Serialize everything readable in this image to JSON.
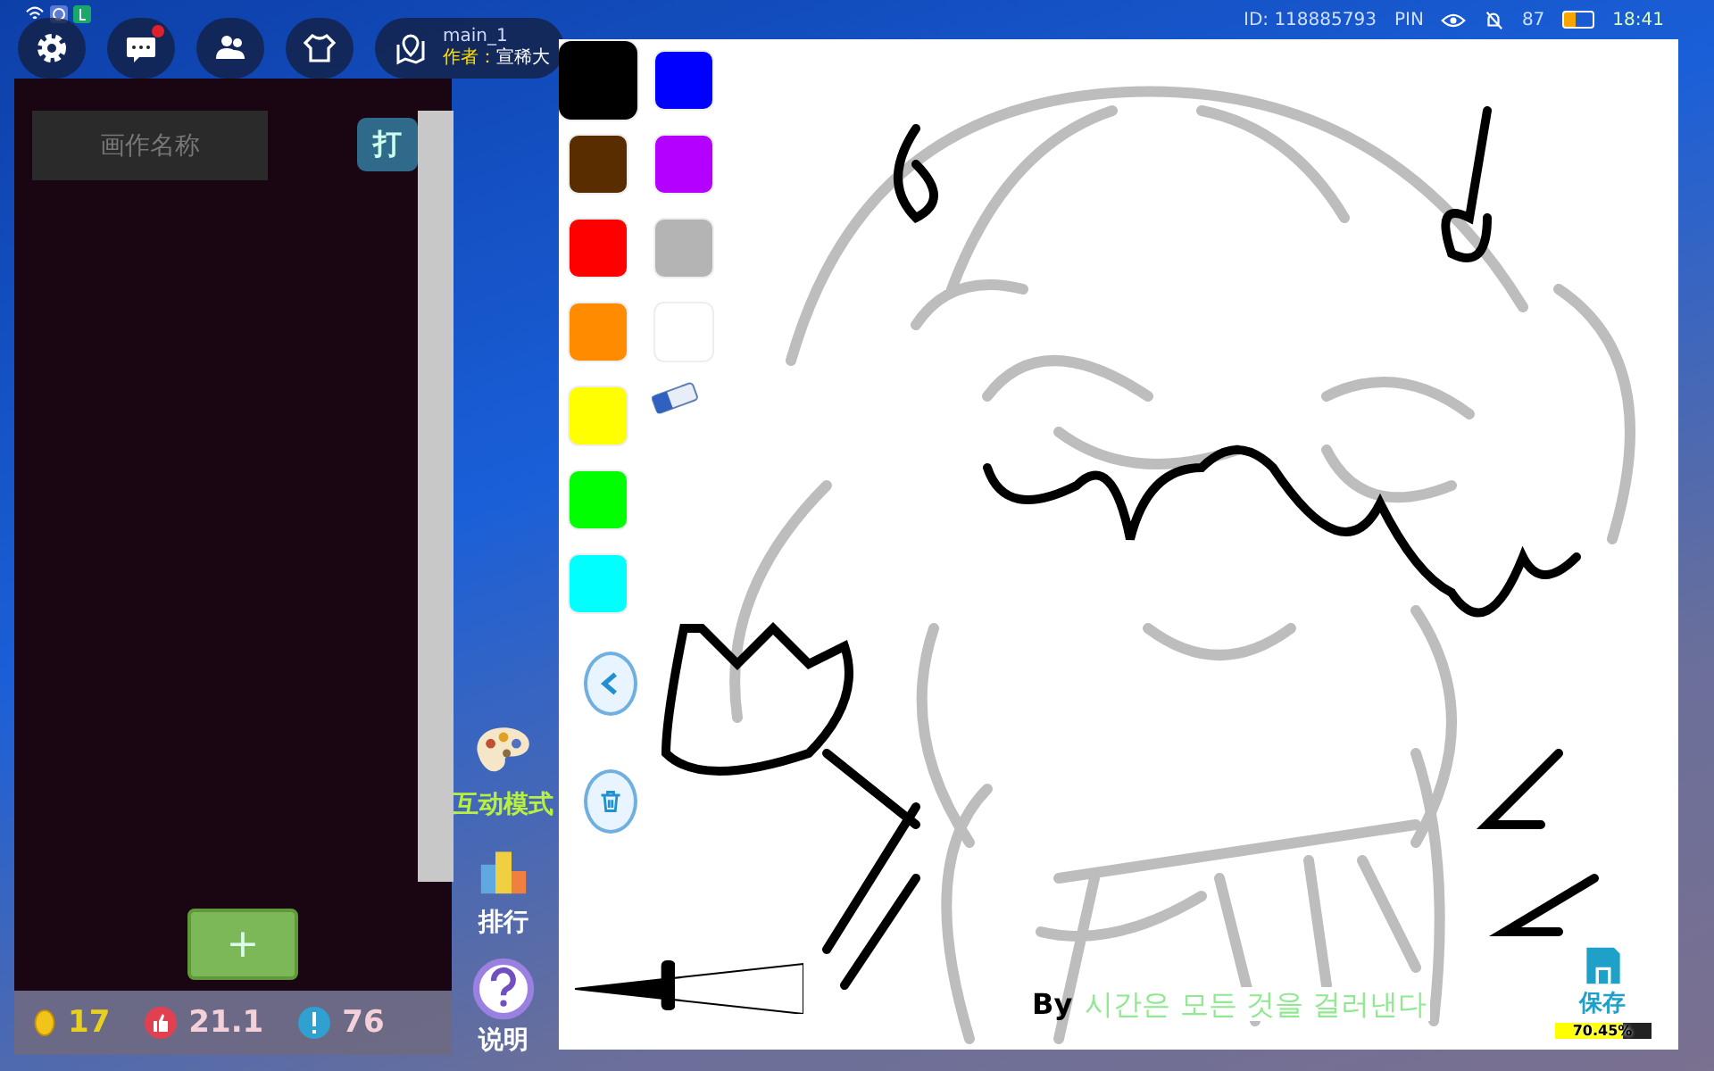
{
  "status_bar": {
    "id": "ID: 118885793",
    "pin": "PIN",
    "battery": "87",
    "time": "18:41"
  },
  "toolbar": {
    "chat_unread": true
  },
  "room": {
    "name": "main_1",
    "author_label": "作者：",
    "author": "宣稀大"
  },
  "artwork_panel": {
    "title_placeholder": "画作名称",
    "open_button": "打",
    "add_button": "+"
  },
  "stats": [
    {
      "kind": "coin",
      "value": "17"
    },
    {
      "kind": "like",
      "value": "21.1"
    },
    {
      "kind": "report",
      "value": "76"
    }
  ],
  "side_menu": [
    {
      "kind": "palette",
      "label": "互动模式"
    },
    {
      "kind": "ranking",
      "label": "排行"
    },
    {
      "kind": "help",
      "label": "说明"
    }
  ],
  "palette": [
    {
      "color": "#000000",
      "selected": true
    },
    {
      "color": "#0000ff",
      "selected": false
    },
    {
      "color": "#5a2d00",
      "selected": false
    },
    {
      "color": "#b400ff",
      "selected": false
    },
    {
      "color": "#ff0000",
      "selected": false
    },
    {
      "color": "#b4b4b4",
      "selected": false
    },
    {
      "color": "#ff8c00",
      "selected": false
    },
    {
      "color": "#ffffff",
      "selected": false
    },
    {
      "color": "#ffff00",
      "selected": false
    },
    {
      "color": "#00ff00",
      "selected": false
    },
    {
      "color": "#00ffff",
      "selected": false
    }
  ],
  "brush_size": {
    "level": 0.44
  },
  "signature": {
    "prefix": "By",
    "author": "시간은 모든 것을 걸러낸다"
  },
  "save": {
    "label": "保存",
    "progress": "70.45%",
    "level": 0.7045
  }
}
